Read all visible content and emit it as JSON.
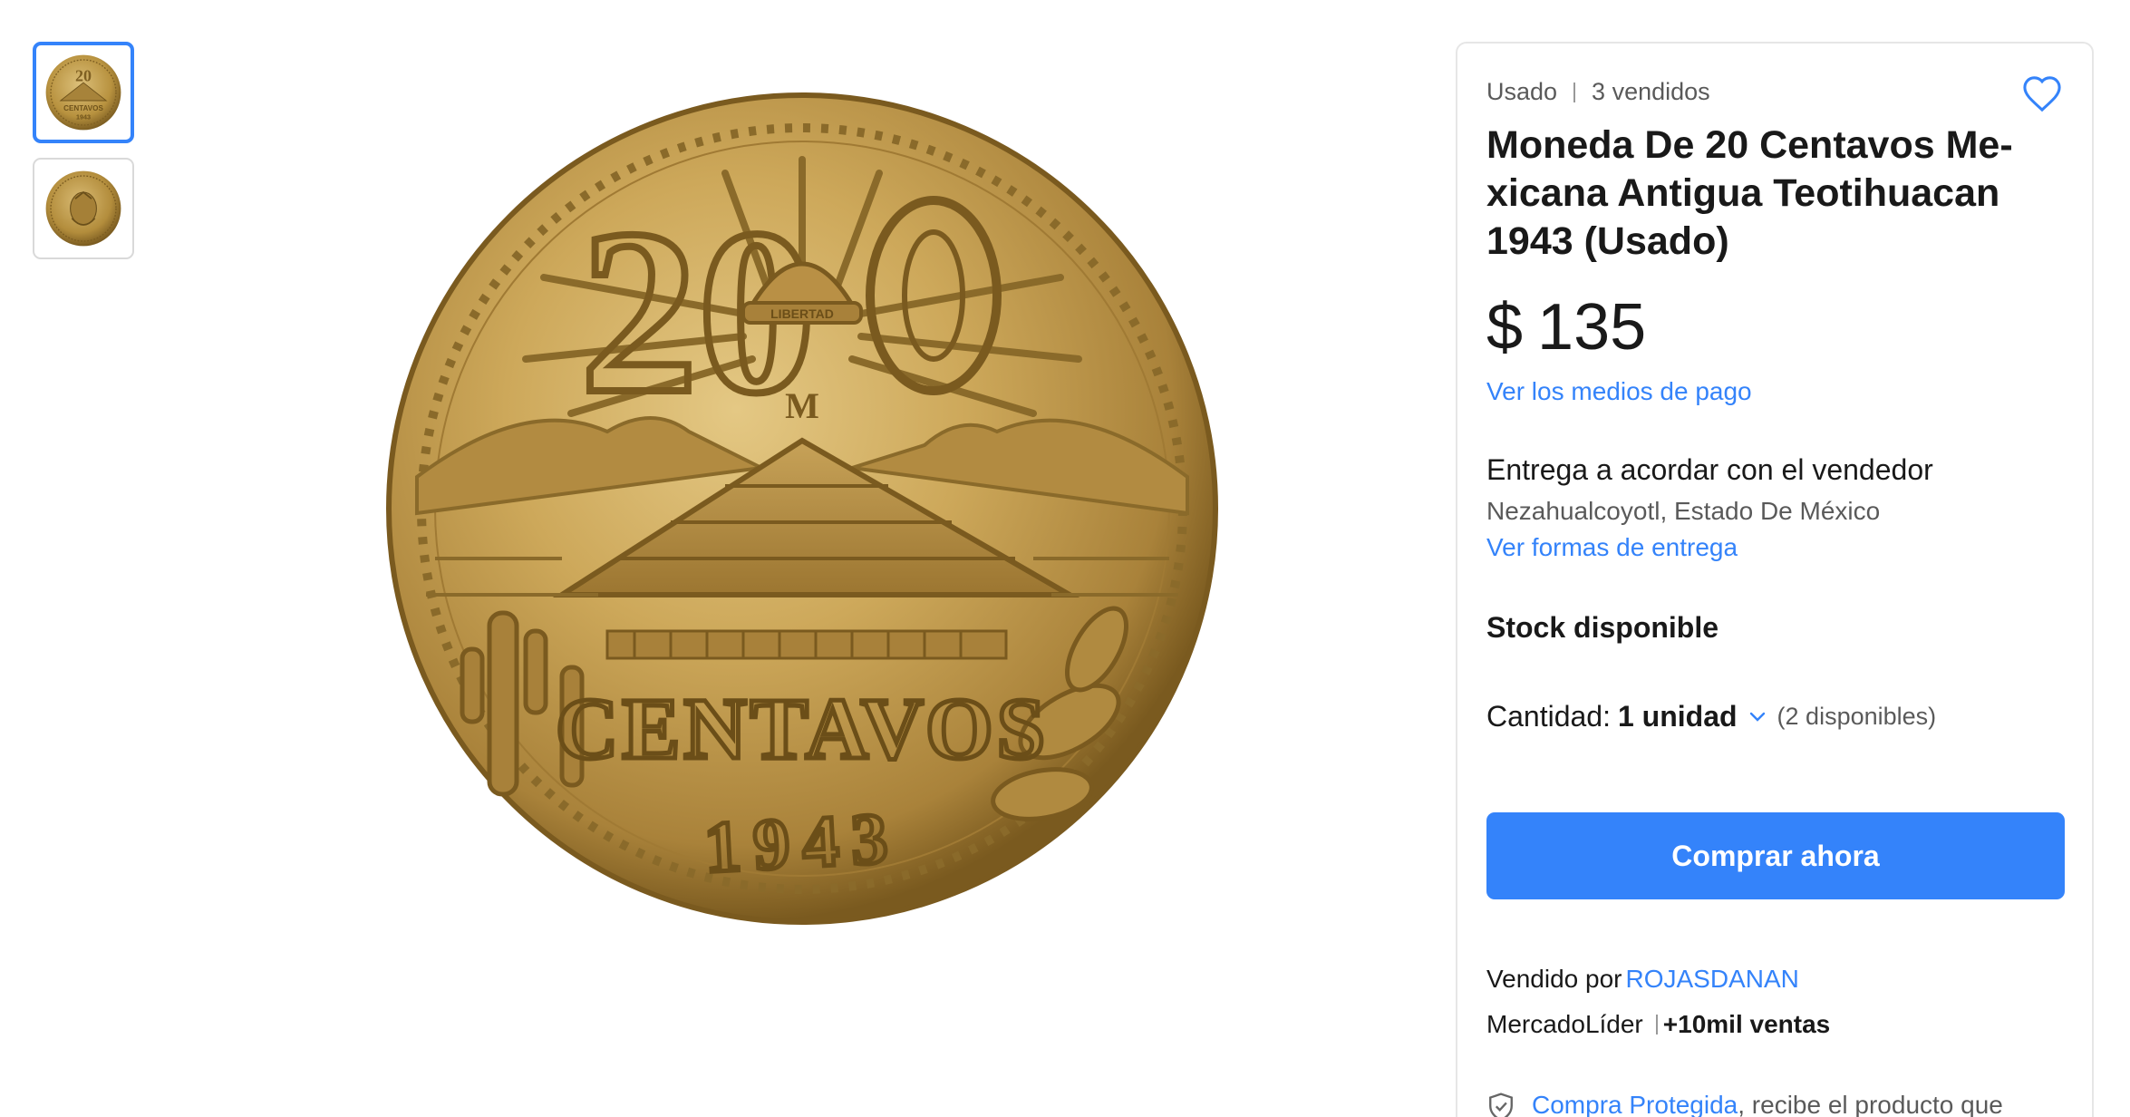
{
  "gallery": {
    "thumbnails": [
      {
        "alt": "coin-front",
        "selected": true
      },
      {
        "alt": "coin-back",
        "selected": false
      }
    ],
    "coin": {
      "denomination": "20",
      "word": "CENTAVOS",
      "year": "1943",
      "mint": "M",
      "cap_text": "LIBERTAD"
    }
  },
  "product": {
    "condition": "Usado",
    "sold": "3 vendidos",
    "title": "Moneda De 20 Centavos Me-xicana Antigua Teotihuacan 1943 (Usado)",
    "currency": "$",
    "price": "135",
    "payment_link": "Ver los medios de pago"
  },
  "shipping": {
    "title": "Entrega a acordar con el vendedor",
    "location": "Nezahualcoyotl, Estado De México",
    "link": "Ver formas de entrega"
  },
  "stock": {
    "label": "Stock disponible",
    "quantity_label": "Cantidad:",
    "quantity_value": "1 unidad",
    "available": "(2 disponibles)"
  },
  "actions": {
    "buy_now": "Comprar ahora"
  },
  "seller": {
    "sold_by": "Vendido por",
    "name": "ROJASDANAN",
    "badge": "MercadoLíder",
    "sales": "+10mil ventas"
  },
  "protection": {
    "link": "Compra Protegida",
    "text": ", recibe el producto que esperabas o te devolvemos tu dinero."
  },
  "colors": {
    "accent": "#3483fa",
    "coin_gold": "#c9a64f",
    "coin_dark": "#8a6a2a"
  },
  "icons": [
    "heart-icon",
    "chevron-down-icon",
    "shield-check-icon"
  ]
}
